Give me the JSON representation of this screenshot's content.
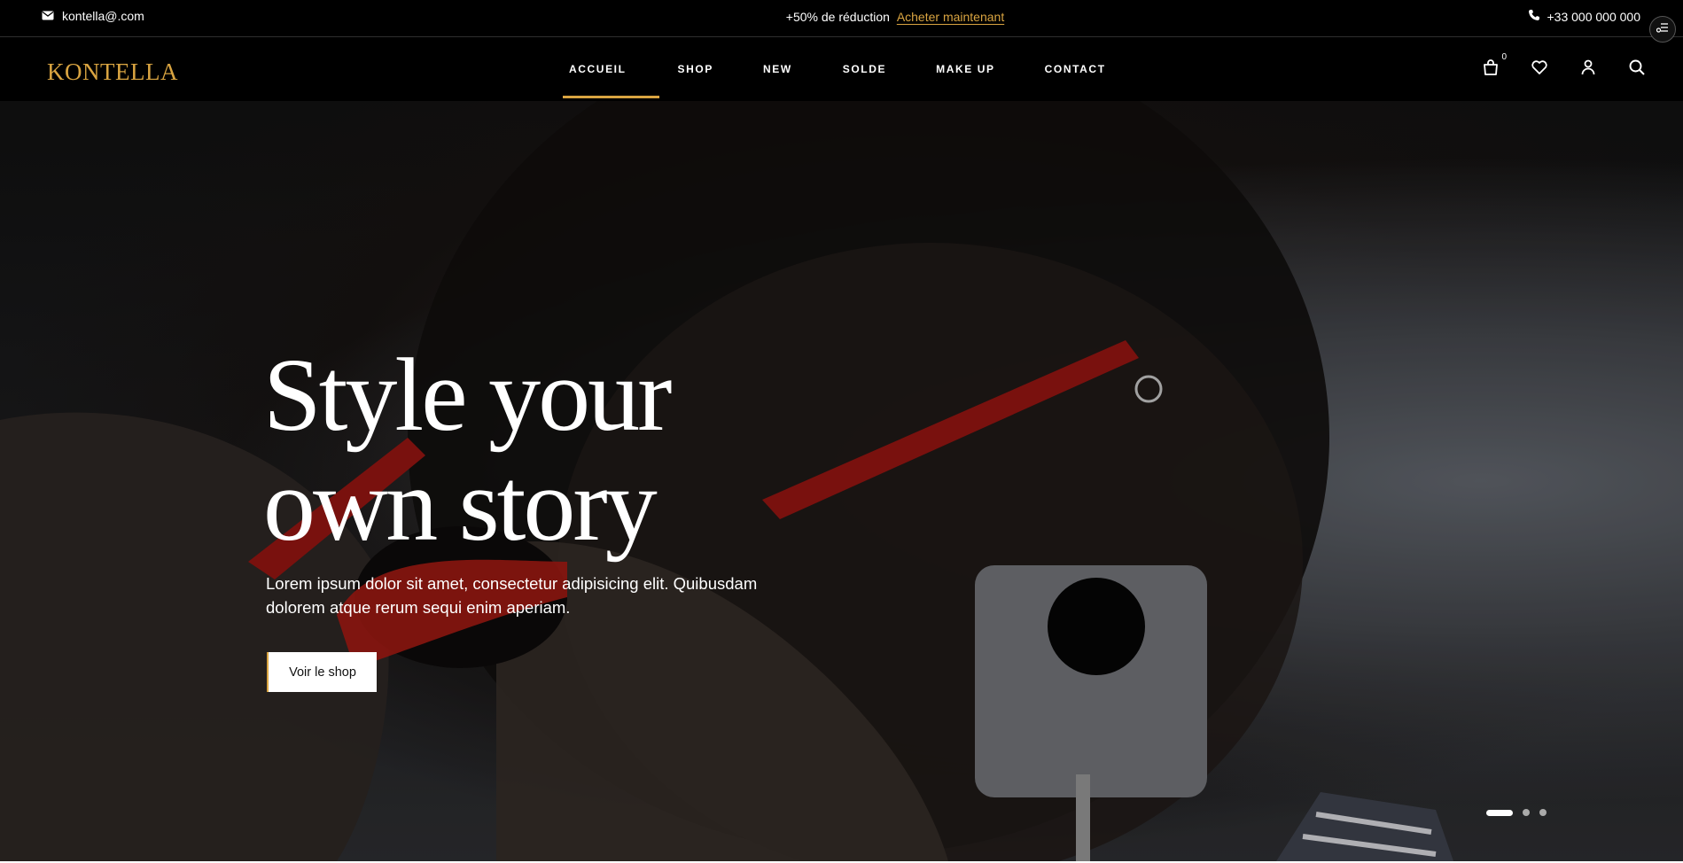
{
  "topbar": {
    "email": "kontella@.com",
    "promo_text": "+50% de réduction",
    "promo_link": "Acheter maintenant",
    "phone": "+33 000 000 000"
  },
  "nav": {
    "logo": "KONTELLA",
    "items": [
      {
        "label": "ACCUEIL",
        "active": true
      },
      {
        "label": "SHOP"
      },
      {
        "label": "NEW"
      },
      {
        "label": "SOLDE"
      },
      {
        "label": "MAKE UP"
      },
      {
        "label": "CONTACT"
      }
    ],
    "cart_count": "0"
  },
  "hero": {
    "title_line1": "Style your",
    "title_line2": "own story",
    "subtitle": "Lorem ipsum dolor sit amet, consectetur adipisicing elit. Quibusdam dolorem atque rerum sequi enim aperiam.",
    "cta": "Voir le shop",
    "slides": 3,
    "active_slide": 1
  },
  "colors": {
    "accent": "#d9a441",
    "background": "#000000",
    "text": "#ffffff"
  }
}
